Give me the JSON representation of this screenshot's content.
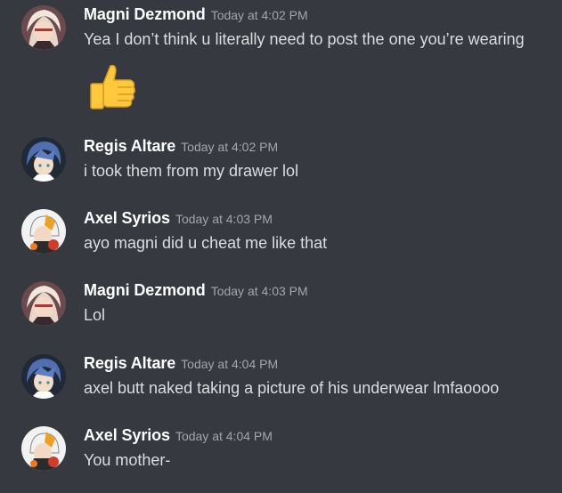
{
  "messages": [
    {
      "author": "Magni Dezmond",
      "timestamp": "Today at 4:02 PM",
      "text": "Yea I don’t think u literally need to post the one you’re wearing",
      "avatar": "magni-avatar",
      "emoji": "thumbs-up-emoji"
    },
    {
      "author": "Regis Altare",
      "timestamp": "Today at 4:02 PM",
      "text": "i took them from my drawer lol",
      "avatar": "regis-avatar"
    },
    {
      "author": "Axel Syrios",
      "timestamp": "Today at 4:03 PM",
      "text": "ayo magni did u cheat me like that",
      "avatar": "axel-avatar"
    },
    {
      "author": "Magni Dezmond",
      "timestamp": "Today at 4:03 PM",
      "text": "Lol",
      "avatar": "magni-avatar"
    },
    {
      "author": "Regis Altare",
      "timestamp": "Today at 4:04 PM",
      "text": "axel butt naked taking a picture of his underwear lmfaoooo",
      "avatar": "regis-avatar"
    },
    {
      "author": "Axel Syrios",
      "timestamp": "Today at 4:04 PM",
      "text": "You mother-",
      "avatar": "axel-avatar"
    }
  ],
  "colors": {
    "background": "#36393f",
    "username": "#ffffff",
    "text": "#dcddde",
    "timestamp": "#a3a6aa"
  }
}
